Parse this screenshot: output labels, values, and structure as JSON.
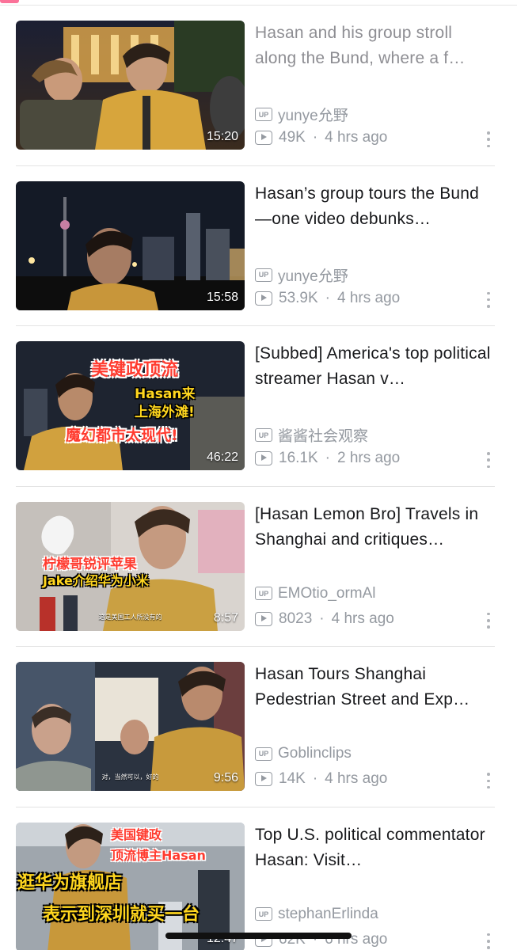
{
  "accent_color": "#fb7299",
  "videos": [
    {
      "title": "Hasan and his group stroll along the Bund, where a f…",
      "title_style": "grey",
      "uploader": "yunye允野",
      "views": "49K",
      "time": "4 hrs ago",
      "duration": "15:20",
      "overlay_text": [],
      "subtitle": ""
    },
    {
      "title": "Hasan’s group tours the Bund—one video debunks…",
      "title_style": "normal",
      "uploader": "yunye允野",
      "views": "53.9K",
      "time": "4 hrs ago",
      "duration": "15:58",
      "overlay_text": [],
      "subtitle": ""
    },
    {
      "title": "[Subbed] America's top political streamer Hasan v…",
      "title_style": "normal",
      "uploader": "酱酱社会观察",
      "views": "16.1K",
      "time": "2 hrs ago",
      "duration": "46:22",
      "overlay_text": [
        "美键政顶流",
        "Hasan来",
        "上海外滩!",
        "魔幻都市太现代!"
      ],
      "subtitle": ""
    },
    {
      "title": "[Hasan Lemon Bro] Travels in Shanghai and critiques…",
      "title_style": "normal",
      "uploader": "EMOtio_ormAl",
      "views": "8023",
      "time": "4 hrs ago",
      "duration": "8:57",
      "overlay_text": [
        "柠檬哥锐评苹果",
        "Jake介绍华为小米"
      ],
      "subtitle": "这是美国工人所没有的"
    },
    {
      "title": "Hasan Tours Shanghai Pedestrian Street and Exp…",
      "title_style": "normal",
      "uploader": "Goblinclips",
      "views": "14K",
      "time": "4 hrs ago",
      "duration": "9:56",
      "overlay_text": [],
      "subtitle": "对，当然可以，好的"
    },
    {
      "title": "Top U.S. political commentator Hasan: Visit…",
      "title_style": "normal",
      "uploader": "stephanErlinda",
      "views": "62K",
      "time": "6 hrs ago",
      "duration": "12:47",
      "overlay_text": [
        "美国键政",
        "顶流博主Hasan",
        "逛华为旗舰店",
        "表示到深圳就买一台"
      ],
      "subtitle": ""
    }
  ]
}
